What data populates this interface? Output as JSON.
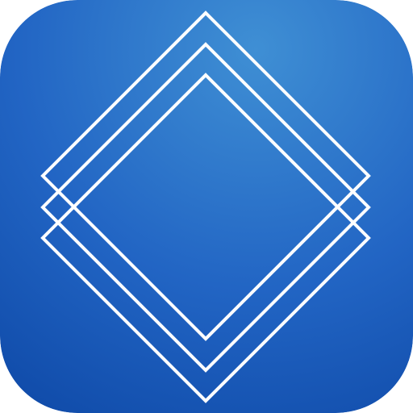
{
  "icon": {
    "name": "layers-icon",
    "colors": {
      "gradient_center": "#3f8fd4",
      "gradient_mid": "#2265c4",
      "gradient_edge": "#0f4aa8",
      "stroke": "#ffffff"
    }
  }
}
